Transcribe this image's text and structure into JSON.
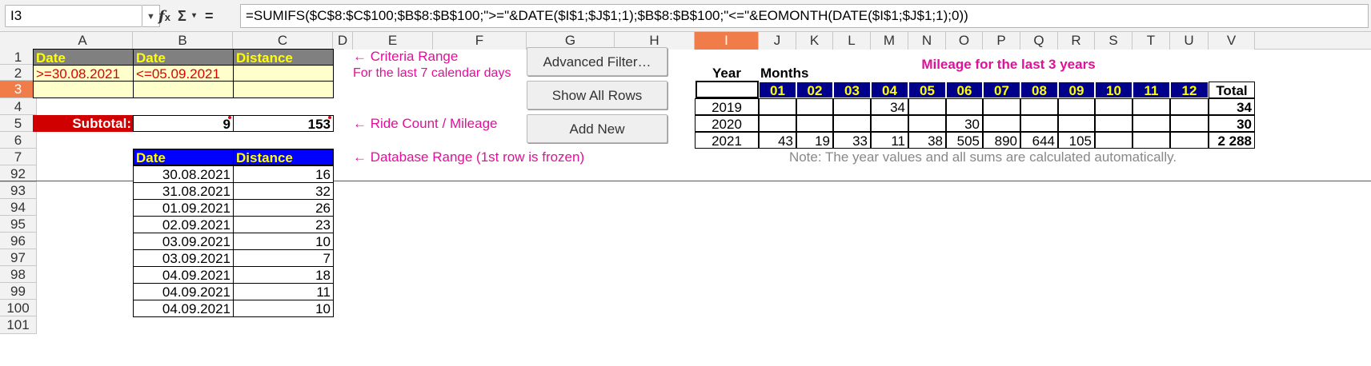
{
  "formula_bar": {
    "name_box": "I3",
    "icons": [
      "function-wizard-icon",
      "sum-icon",
      "chevron-down-icon",
      "equals-icon"
    ],
    "formula": "=SUMIFS($C$8:$C$100;$B$8:$B$100;\">=\"&DATE($I$1;$J$1;1);$B$8:$B$100;\"<=\"&EOMONTH(DATE($I$1;$J$1;1);0))"
  },
  "columns": [
    "A",
    "B",
    "C",
    "D",
    "E",
    "F",
    "G",
    "H",
    "I",
    "J",
    "K",
    "L",
    "M",
    "N",
    "O",
    "P",
    "Q",
    "R",
    "S",
    "T",
    "U",
    "V"
  ],
  "rows": [
    "1",
    "2",
    "3",
    "4",
    "5",
    "6",
    "7",
    "92",
    "93",
    "94",
    "95",
    "96",
    "97",
    "98",
    "99",
    "100",
    "101"
  ],
  "criteria": {
    "headers": [
      "Date",
      "Date",
      "Distance"
    ],
    "values": [
      ">=30.08.2021",
      "<=05.09.2021",
      ""
    ]
  },
  "subtotal": {
    "label": "Subtotal:",
    "count": "9",
    "mileage": "153"
  },
  "annotations": {
    "criteria_range": "← Criteria Range",
    "last_days": "For the last 7 calendar days",
    "ride_count": "← Ride Count / Mileage",
    "database_range": "← Database Range (1st row is frozen)"
  },
  "buttons": {
    "advanced_filter": "Advanced Filter…",
    "show_all_rows": "Show All Rows",
    "add_new": "Add New"
  },
  "database": {
    "headers": [
      "Date",
      "Distance"
    ],
    "rows": [
      [
        "30.08.2021",
        "16"
      ],
      [
        "31.08.2021",
        "32"
      ],
      [
        "01.09.2021",
        "26"
      ],
      [
        "02.09.2021",
        "23"
      ],
      [
        "03.09.2021",
        "10"
      ],
      [
        "03.09.2021",
        "7"
      ],
      [
        "04.09.2021",
        "18"
      ],
      [
        "04.09.2021",
        "11"
      ],
      [
        "04.09.2021",
        "10"
      ]
    ]
  },
  "mileage": {
    "title": "Mileage for the last 3 years",
    "year_label": "Year",
    "months_label": "Months",
    "months": [
      "01",
      "02",
      "03",
      "04",
      "05",
      "06",
      "07",
      "08",
      "09",
      "10",
      "11",
      "12"
    ],
    "total_label": "Total",
    "rows": [
      {
        "year": "2019",
        "values": [
          "",
          "",
          "",
          "34",
          "",
          "",
          "",
          "",
          "",
          "",
          "",
          ""
        ],
        "total": "34"
      },
      {
        "year": "2020",
        "values": [
          "",
          "",
          "",
          "",
          "",
          "30",
          "",
          "",
          "",
          "",
          "",
          ""
        ],
        "total": "30"
      },
      {
        "year": "2021",
        "values": [
          "43",
          "19",
          "33",
          "11",
          "38",
          "505",
          "890",
          "644",
          "105",
          "",
          "",
          ""
        ],
        "total": "2 288"
      }
    ],
    "note": "Note: The year values and all sums are calculated automatically."
  },
  "colors": {
    "header_gray": "#808080",
    "criteria_fill": "#ffffcc",
    "subtotal_red": "#d00000",
    "db_header_blue": "#0000ff",
    "month_header_navy": "#00008b",
    "annotation_magenta": "#e0109a",
    "selection_orange": "#f07c4a"
  }
}
